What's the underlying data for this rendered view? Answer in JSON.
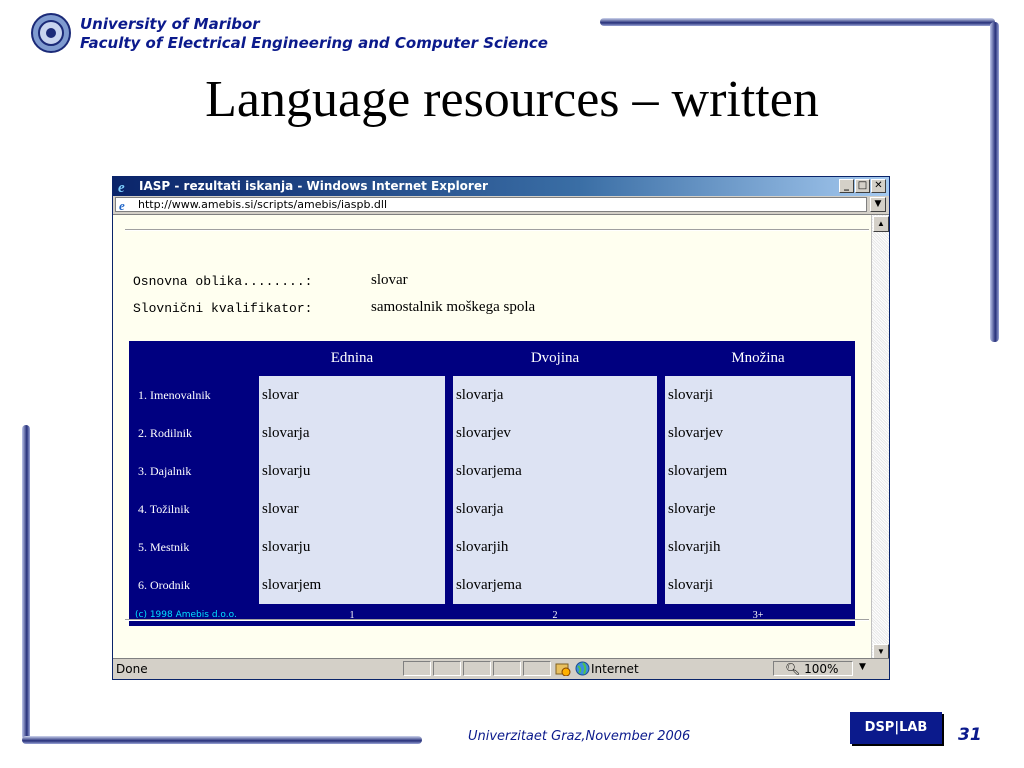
{
  "slide": {
    "university": "University of Maribor",
    "faculty": "Faculty of Electrical Engineering and Computer Science",
    "title": "Language resources – written",
    "footer": "Univerzitaet Graz,November 2006",
    "logo_text": "DSP|LAB",
    "page_number": "31"
  },
  "browser": {
    "title": "IASP - rezultati iskanja - Windows Internet Explorer",
    "url": "http://www.amebis.si/scripts/amebis/iaspb.dll",
    "status": "Done",
    "zone": "Internet",
    "zoom": "100%"
  },
  "page": {
    "basic_form_label": "Osnovna oblika........:",
    "basic_form_value": "slovar",
    "qualifier_label": "Slovnični kvalifikator:",
    "qualifier_value": "samostalnik moškega spola",
    "columns": [
      "Ednina",
      "Dvojina",
      "Množina"
    ],
    "rows": [
      {
        "case": "1. Imenovalnik",
        "values": [
          "slovar",
          "slovarja",
          "slovarji"
        ]
      },
      {
        "case": "2. Rodilnik",
        "values": [
          "slovarja",
          "slovarjev",
          "slovarjev"
        ]
      },
      {
        "case": "3. Dajalnik",
        "values": [
          "slovarju",
          "slovarjema",
          "slovarjem"
        ]
      },
      {
        "case": "4. Tožilnik",
        "values": [
          "slovar",
          "slovarja",
          "slovarje"
        ]
      },
      {
        "case": "5. Mestnik",
        "values": [
          "slovarju",
          "slovarjih",
          "slovarjih"
        ]
      },
      {
        "case": "6. Orodnik",
        "values": [
          "slovarjem",
          "slovarjema",
          "slovarji"
        ]
      }
    ],
    "copyright": "(c) 1998 Amebis d.o.o.",
    "footer_numbers": [
      "1",
      "2",
      "3+"
    ]
  },
  "colors": {
    "table_bg": "#000080",
    "cell_bg": "#dde3f3",
    "page_bg": "#fffff0",
    "slide_accent": "#0b1a8c"
  }
}
